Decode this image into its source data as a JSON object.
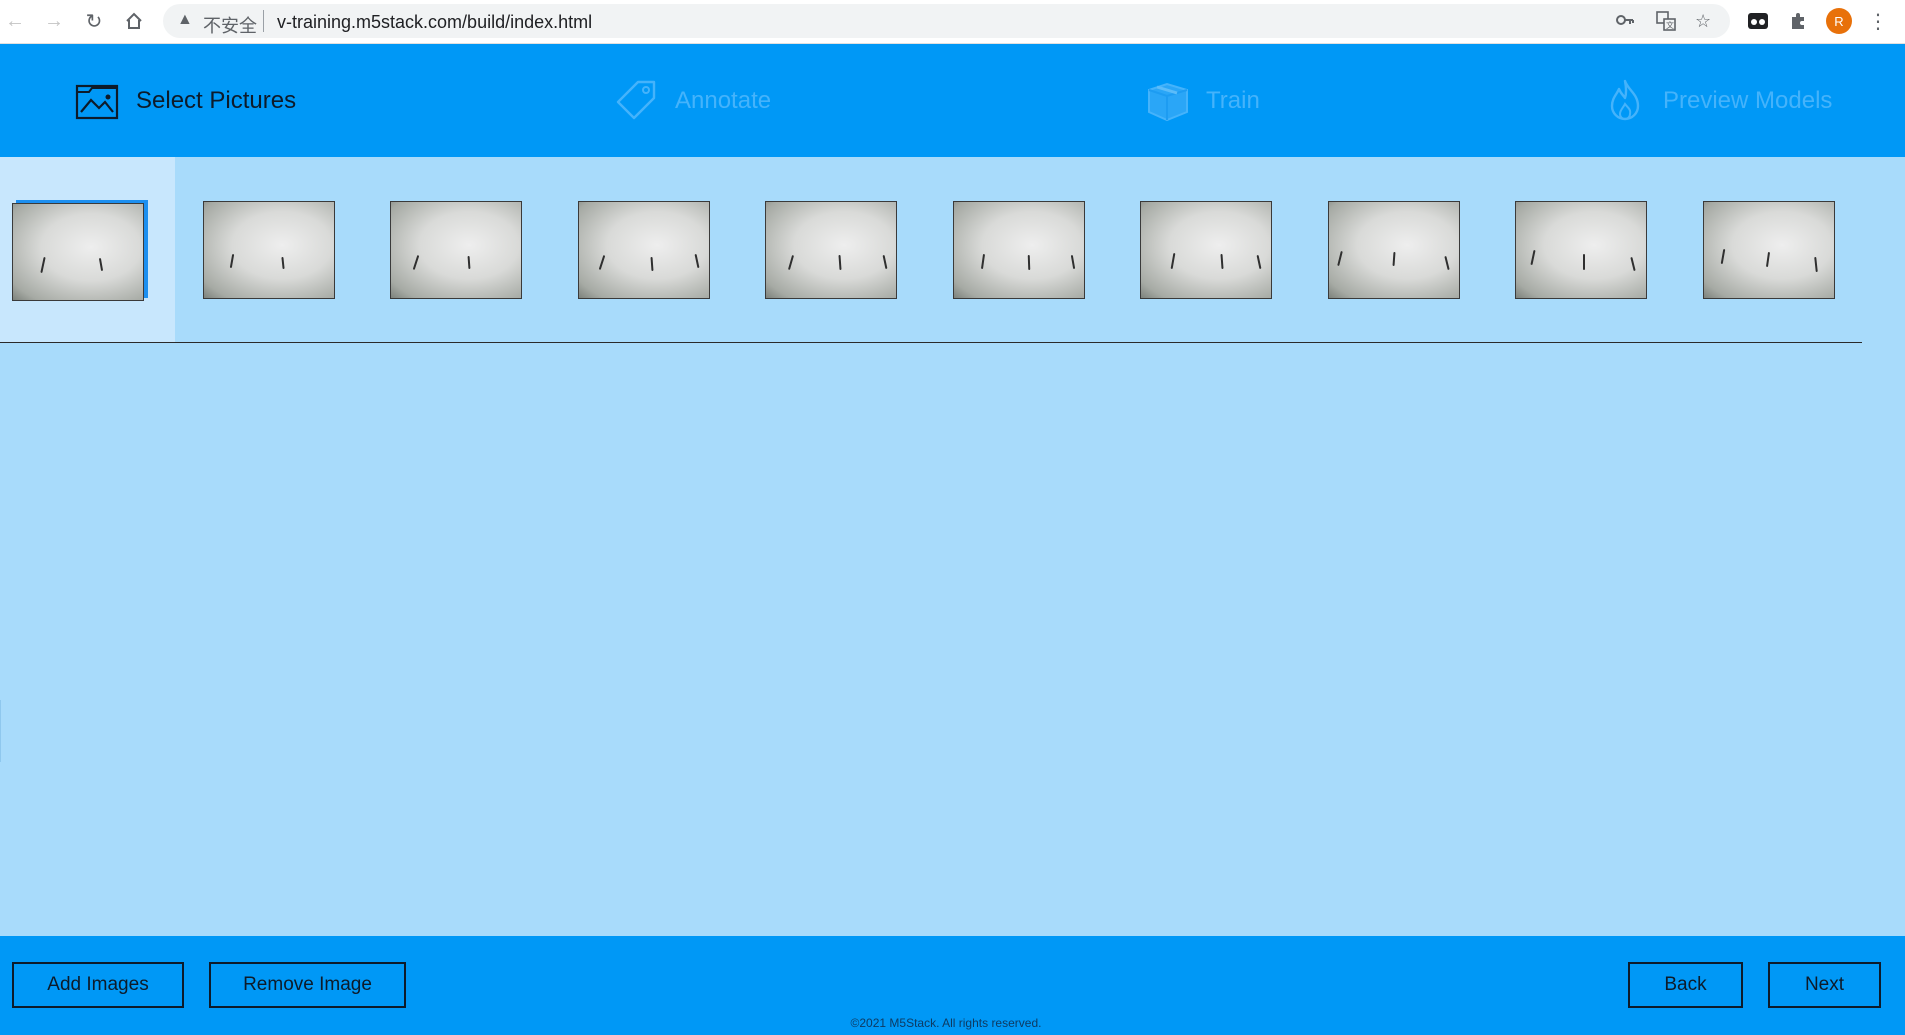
{
  "browser": {
    "security_label": "不安全",
    "url": "v-training.m5stack.com/build/index.html",
    "profile_initial": "R",
    "icons": [
      "back-icon",
      "forward-icon",
      "reload-icon",
      "home-icon",
      "warning-icon",
      "key-icon",
      "translate-icon",
      "star-icon",
      "extension-app-icon",
      "puzzle-icon",
      "kebab-menu-icon"
    ]
  },
  "steps": [
    {
      "label": "Select Pictures",
      "icon": "picture-icon",
      "state": "active"
    },
    {
      "label": "Annotate",
      "icon": "tag-icon",
      "state": "inactive"
    },
    {
      "label": "Train",
      "icon": "box-icon",
      "state": "inactive"
    },
    {
      "label": "Preview Models",
      "icon": "flame-icon",
      "state": "inactive"
    }
  ],
  "thumbnails": {
    "count": 10,
    "selected_index": 0
  },
  "footer": {
    "add_images_label": "Add Images",
    "remove_image_label": "Remove Image",
    "back_label": "Back",
    "next_label": "Next",
    "copyright": "©2021 M5Stack. All rights reserved."
  },
  "colors": {
    "header": "#0098f6",
    "content": "#a8dbfb",
    "selected_bg": "#c8e7fd",
    "active_text": "#0d1b2a",
    "inactive_text": "#45b3fb"
  }
}
